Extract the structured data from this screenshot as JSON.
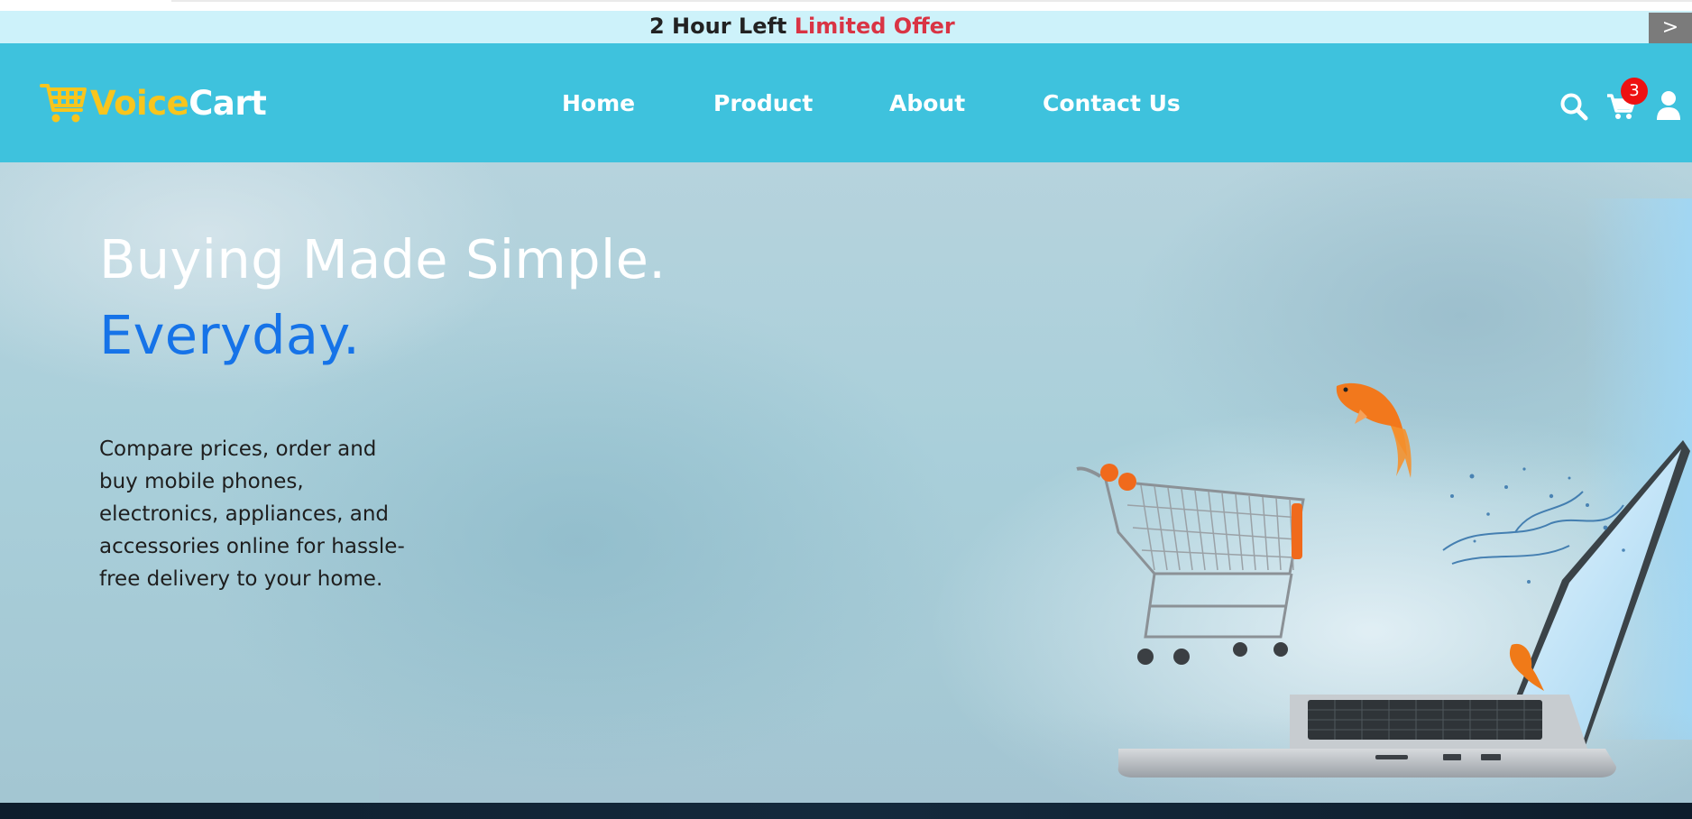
{
  "offer": {
    "prefix": "2 Hour Left",
    "highlight": "Limited Offer",
    "next_label": ">"
  },
  "brand": {
    "name_part1": "Voice",
    "name_part2": "Cart",
    "icon": "shopping-cart-icon",
    "colors": {
      "part1": "#f8c51d",
      "part2": "#ffffff"
    }
  },
  "nav": {
    "links": [
      "Home",
      "Product",
      "About",
      "Contact Us"
    ],
    "icons": [
      "search-icon",
      "cart-icon",
      "user-icon"
    ],
    "cart_count": "3",
    "background": "#3ec2dd"
  },
  "hero": {
    "headline": "Buying Made Simple.",
    "headline_accent": "Everyday.",
    "description_lines": [
      "Compare prices, order and",
      "buy mobile phones,",
      "electronics, appliances, and",
      "accessories online for hassle-",
      "free delivery to your home."
    ],
    "accent_color": "#1673e8"
  }
}
